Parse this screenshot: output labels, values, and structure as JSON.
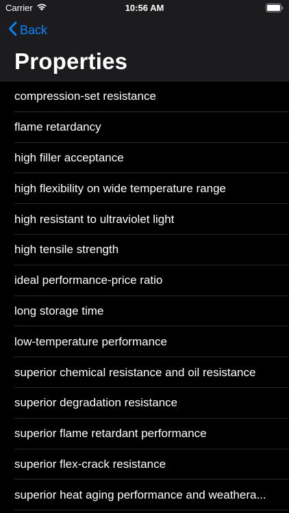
{
  "status_bar": {
    "carrier": "Carrier",
    "time": "10:56 AM"
  },
  "nav": {
    "back_label": "Back",
    "title": "Properties"
  },
  "colors": {
    "accent": "#0a84ff",
    "background": "#000000",
    "header": "#1c1c1e"
  },
  "properties": {
    "items": [
      {
        "label": "compression-set resistance"
      },
      {
        "label": "flame retardancy"
      },
      {
        "label": "high filler acceptance"
      },
      {
        "label": "high flexibility on wide temperature range"
      },
      {
        "label": "high resistant to ultraviolet light"
      },
      {
        "label": "high tensile strength"
      },
      {
        "label": "ideal performance-price ratio"
      },
      {
        "label": "long storage time"
      },
      {
        "label": "low-temperature performance"
      },
      {
        "label": "superior chemical resistance and oil resistance"
      },
      {
        "label": "superior degradation resistance"
      },
      {
        "label": "superior flame retardant performance"
      },
      {
        "label": "superior flex-crack resistance"
      },
      {
        "label": "superior heat aging performance and weathera..."
      }
    ]
  }
}
